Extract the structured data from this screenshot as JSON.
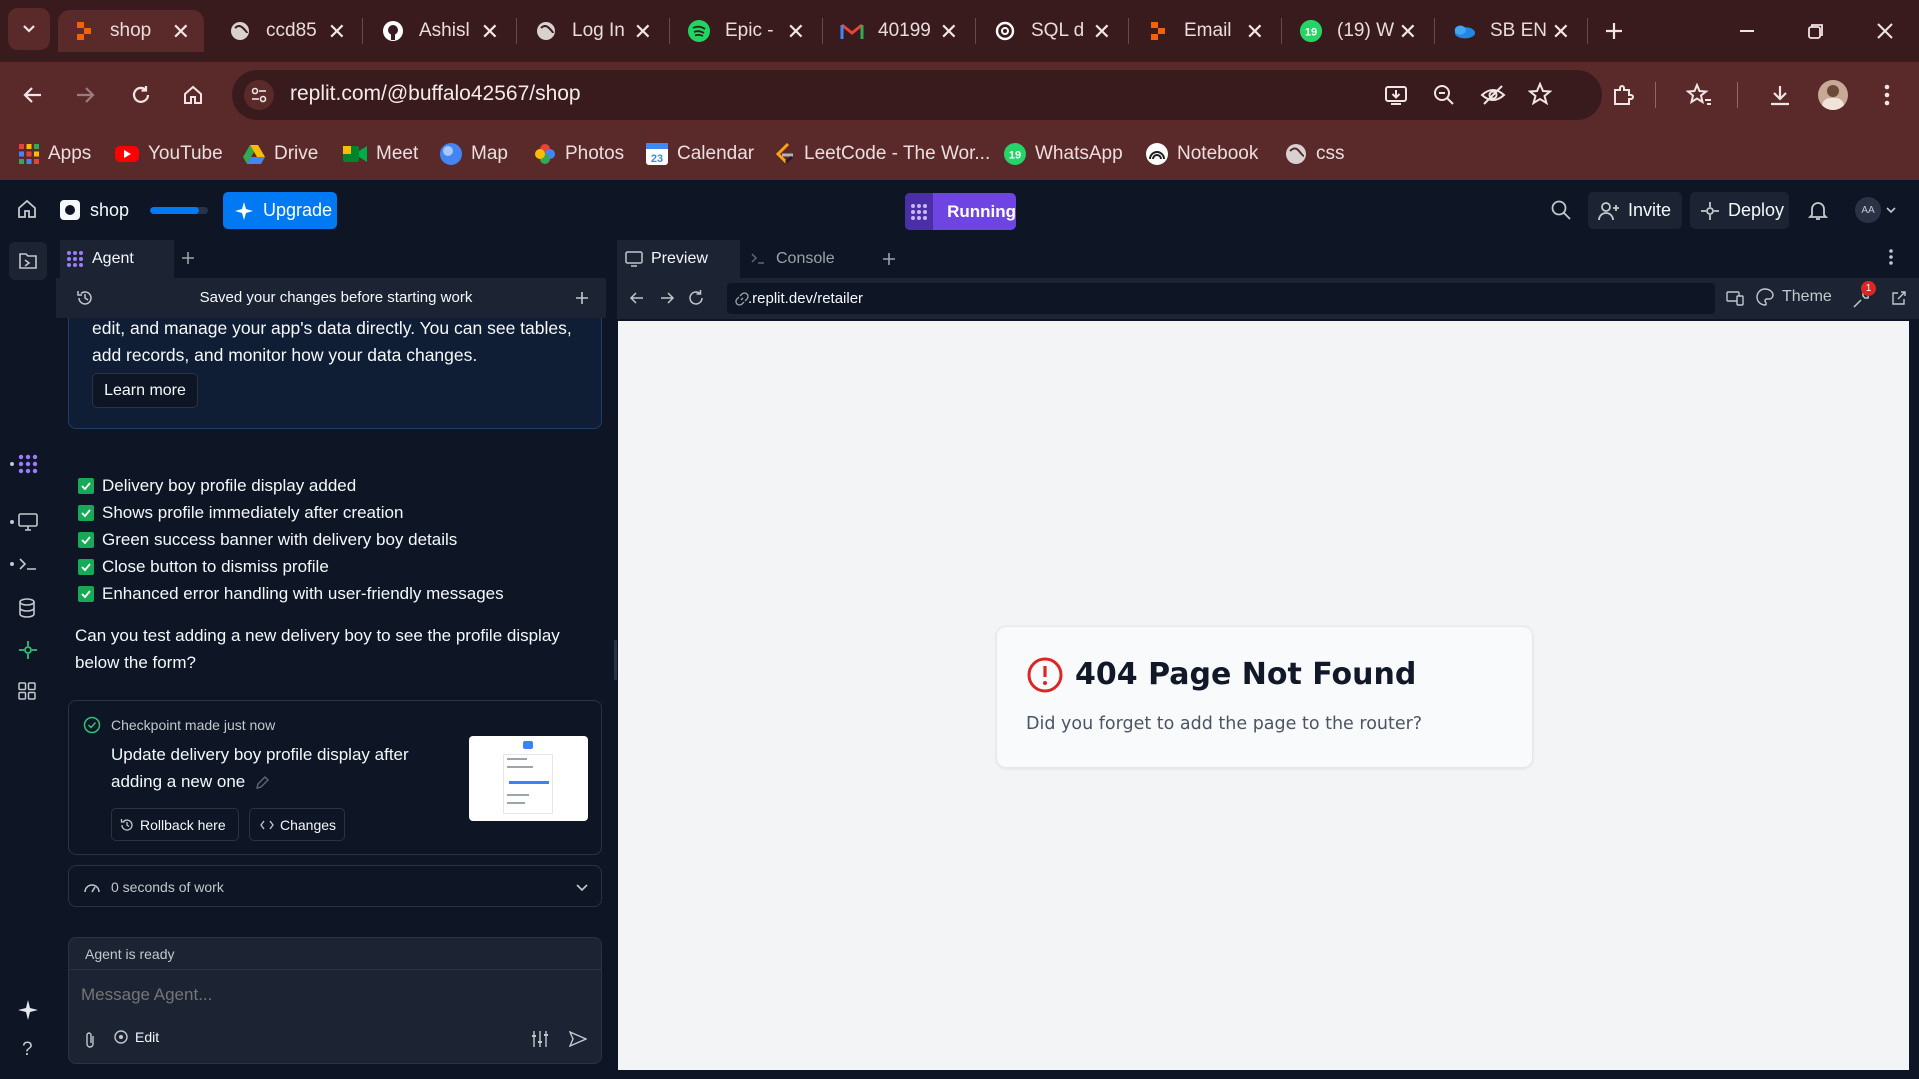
{
  "browser": {
    "tabs": [
      {
        "title": "shop",
        "icon": "replit",
        "active": true
      },
      {
        "title": "ccd85",
        "icon": "globe"
      },
      {
        "title": "Ashisl",
        "icon": "github"
      },
      {
        "title": "Log In",
        "icon": "globe"
      },
      {
        "title": "Epic -",
        "icon": "spotify"
      },
      {
        "title": "40199",
        "icon": "gmail"
      },
      {
        "title": "SQL d",
        "icon": "openai"
      },
      {
        "title": "Email",
        "icon": "replit"
      },
      {
        "title": "(19) W",
        "icon": "whatsapp",
        "badge": "19"
      },
      {
        "title": "SB EN",
        "icon": "onedrive"
      }
    ],
    "url": "replit.com/@buffalo42567/shop",
    "bookmarks": [
      {
        "label": "Apps",
        "icon": "apps",
        "color": "#ea4335"
      },
      {
        "label": "YouTube",
        "icon": "youtube",
        "color": "#ff0000"
      },
      {
        "label": "Drive",
        "icon": "drive",
        "color": "#34a853"
      },
      {
        "label": "Meet",
        "icon": "meet",
        "color": "#00897b"
      },
      {
        "label": "Map",
        "icon": "map",
        "color": "#4285f4"
      },
      {
        "label": "Photos",
        "icon": "photos",
        "color": "#fbbc04"
      },
      {
        "label": "Calendar",
        "icon": "calendar",
        "color": "#4285f4"
      },
      {
        "label": "LeetCode - The Wor...",
        "icon": "leetcode",
        "color": "#ffa116"
      },
      {
        "label": "WhatsApp",
        "icon": "whatsapp",
        "color": "#25d366"
      },
      {
        "label": "Notebook",
        "icon": "notebook",
        "color": "#ffffff"
      },
      {
        "label": "css",
        "icon": "globe",
        "color": "#9aa0a6"
      }
    ]
  },
  "topbar": {
    "project_name": "shop",
    "upgrade_label": "Upgrade",
    "run_label": "Running",
    "invite_label": "Invite",
    "deploy_label": "Deploy",
    "avatar_initials": "AA"
  },
  "agent": {
    "tab_label": "Agent",
    "history_banner": "Saved your changes before starting work",
    "info_text": "edit, and manage your app's data directly. You can see tables, add records, and monitor how your data changes.",
    "learn_more": "Learn more",
    "checklist": [
      "Delivery boy profile display added",
      "Shows profile immediately after creation",
      "Green success banner with delivery boy details",
      "Close button to dismiss profile",
      "Enhanced error handling with user-friendly messages"
    ],
    "question": "Can you test adding a new delivery boy to see the profile display below the form?",
    "checkpoint": {
      "label": "Checkpoint made just now",
      "title": "Update delivery boy profile display after adding a new one",
      "rollback_label": "Rollback here",
      "changes_label": "Changes"
    },
    "work_time": "0 seconds of work",
    "status": "Agent is ready",
    "input_placeholder": "Message Agent...",
    "edit_label": "Edit"
  },
  "preview": {
    "tabs": [
      {
        "label": "Preview",
        "active": true
      },
      {
        "label": "Console"
      }
    ],
    "url": ".replit.dev/retailer",
    "theme_label": "Theme",
    "notification_badge": "1",
    "error_title": "404 Page Not Found",
    "error_message": "Did you forget to add the page to the router?"
  },
  "colors": {
    "accent": "#0079f2",
    "run": "#6e45e2",
    "checkbox": "#18a957",
    "error": "#dc2626",
    "chrome_bg": "#5a2a2a"
  }
}
